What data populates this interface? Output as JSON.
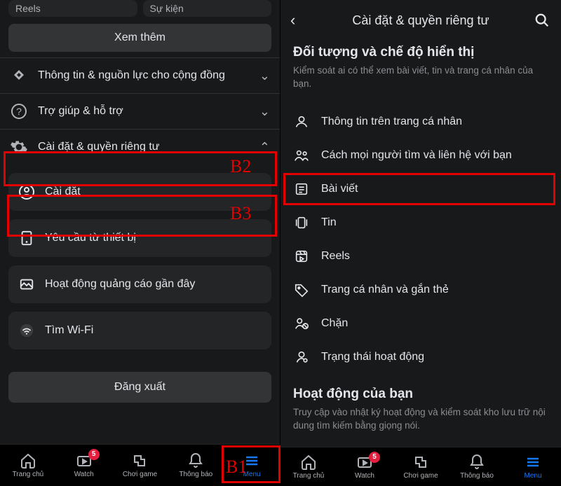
{
  "annotations": {
    "b1": "B1",
    "b2": "B2",
    "b3": "B3"
  },
  "left": {
    "chips": {
      "reels": "Reels",
      "events": "Sự kiện"
    },
    "see_more": "Xem thêm",
    "rows": {
      "community": "Thông tin & nguồn lực cho cộng đồng",
      "help": "Trợ giúp & hỗ trợ",
      "settings_privacy": "Cài đặt & quyền riêng tư"
    },
    "cards": {
      "settings": "Cài đặt",
      "device_requests": "Yêu cầu từ thiết bị",
      "recent_ad_activity": "Hoạt động quảng cáo gần đây",
      "find_wifi": "Tìm Wi-Fi"
    },
    "logout": "Đăng xuất",
    "tabs": {
      "home": "Trang chủ",
      "watch": "Watch",
      "gaming": "Chơi game",
      "notifications": "Thông báo",
      "menu": "Menu",
      "badge": "5"
    }
  },
  "right": {
    "header": {
      "title": "Cài đặt & quyền riêng tư"
    },
    "section1": {
      "title": "Đối tượng và chế độ hiển thị",
      "desc": "Kiểm soát ai có thể xem bài viết, tin và trang cá nhân của bạn."
    },
    "items": {
      "profile_info": "Thông tin trên trang cá nhân",
      "find_contact": "Cách mọi người tìm và liên hệ với bạn",
      "posts": "Bài viết",
      "stories": "Tin",
      "reels": "Reels",
      "profile_tagging": "Trang cá nhân và gắn thẻ",
      "block": "Chặn",
      "active_status": "Trạng thái hoạt động"
    },
    "section2": {
      "title": "Hoạt động của bạn",
      "desc": "Truy cập vào nhật ký hoạt động và kiểm soát kho lưu trữ nội dung tìm kiếm bằng giọng nói."
    },
    "tabs": {
      "home": "Trang chủ",
      "watch": "Watch",
      "gaming": "Chơi game",
      "notifications": "Thông báo",
      "menu": "Menu",
      "badge": "5"
    }
  }
}
